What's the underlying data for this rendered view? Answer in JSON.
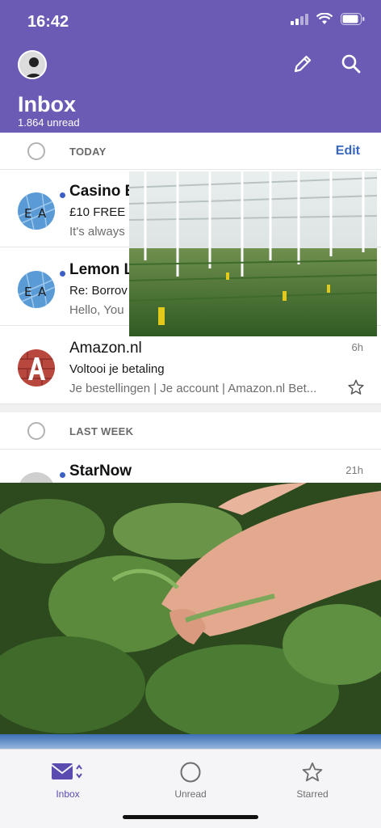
{
  "status_bar": {
    "time": "16:42"
  },
  "header": {
    "title": "Inbox",
    "unread_count": "1.864 unread"
  },
  "sections": {
    "today": {
      "label": "TODAY",
      "action": "Edit"
    },
    "last_week": {
      "label": "LAST WEEK"
    }
  },
  "messages": [
    {
      "sender": "Casino E",
      "subject": "£10 FREE -",
      "preview": "It's always",
      "unread": true,
      "avatar": "EA"
    },
    {
      "sender": "Lemon L",
      "subject": "Re: Borrov",
      "preview": "Hello, You",
      "unread": true,
      "avatar": "EA"
    },
    {
      "sender": "Amazon.nl",
      "subject": "Voltooi je betaling",
      "preview": "Je bestellingen | Je account | Amazon.nl Bet...",
      "time": "6h",
      "unread": false,
      "avatar": "A"
    },
    {
      "sender": "StarNow",
      "time": "21h",
      "unread": true
    }
  ],
  "tabbar": {
    "tabs": [
      {
        "label": "Inbox",
        "icon": "inbox-envelope-icon",
        "active": true
      },
      {
        "label": "Unread",
        "icon": "circle-icon",
        "active": false
      },
      {
        "label": "Starred",
        "icon": "star-icon",
        "active": false
      }
    ]
  },
  "colors": {
    "header_bg": "#6b5bb5",
    "accent_blue": "#3666c0",
    "unread_dot": "#3b5fc4",
    "tab_active": "#5a4bb0"
  }
}
